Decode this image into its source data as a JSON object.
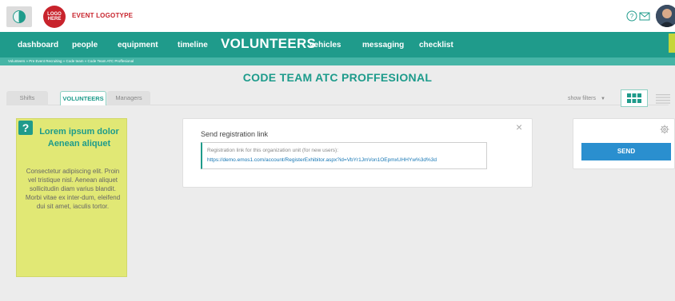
{
  "header": {
    "logo_line1": "LOGO",
    "logo_line2": "HERE",
    "logotype": "EVENT LOGOTYPE",
    "app_icon": "leaf-icon",
    "help_icon": "help-circle-icon",
    "mail_icon": "mail-icon"
  },
  "nav": {
    "items": [
      {
        "label": "dashboard"
      },
      {
        "label": "people"
      },
      {
        "label": "equipment"
      },
      {
        "label": "timeline"
      },
      {
        "label": "VOLUNTEERS"
      },
      {
        "label": "vehicles"
      },
      {
        "label": "messaging"
      },
      {
        "label": "checklist"
      }
    ]
  },
  "breadcrumb": "Volunteers » Pre Event Recruiting » Code team » Code Team ATC Proffesional",
  "page_title": "CODE TEAM ATC PROFFESIONAL",
  "tabs": [
    {
      "label": "Shifts"
    },
    {
      "label": "VOLUNTEERS"
    },
    {
      "label": "Managers"
    }
  ],
  "toolbar": {
    "show_filters": "show filters"
  },
  "help_card": {
    "badge": "?",
    "title": "Lorem ipsum dolor Aenean aliquet",
    "text": "Consectetur adipiscing elit. Proin vel tristique nisl. Aenean aliquet sollicitudin diam varius blandit. Morbi vitae ex inter-dum, eleifend dui sit amet, iaculis tortor."
  },
  "registration": {
    "title": "Send registration link",
    "close": "×",
    "description": "Registration link for this organization unit (for new users):",
    "link": "https://demo.emos1.com/account/RegisterExhibitor.aspx?id=VbYr1JmVon1OEpmxUHHYw%3d%3d"
  },
  "send_card": {
    "button": "SEND"
  },
  "colors": {
    "accent": "#1f9b8b",
    "brand_red": "#c8232c",
    "send_blue": "#2a8fcf",
    "help_yellow": "#e1e875"
  }
}
